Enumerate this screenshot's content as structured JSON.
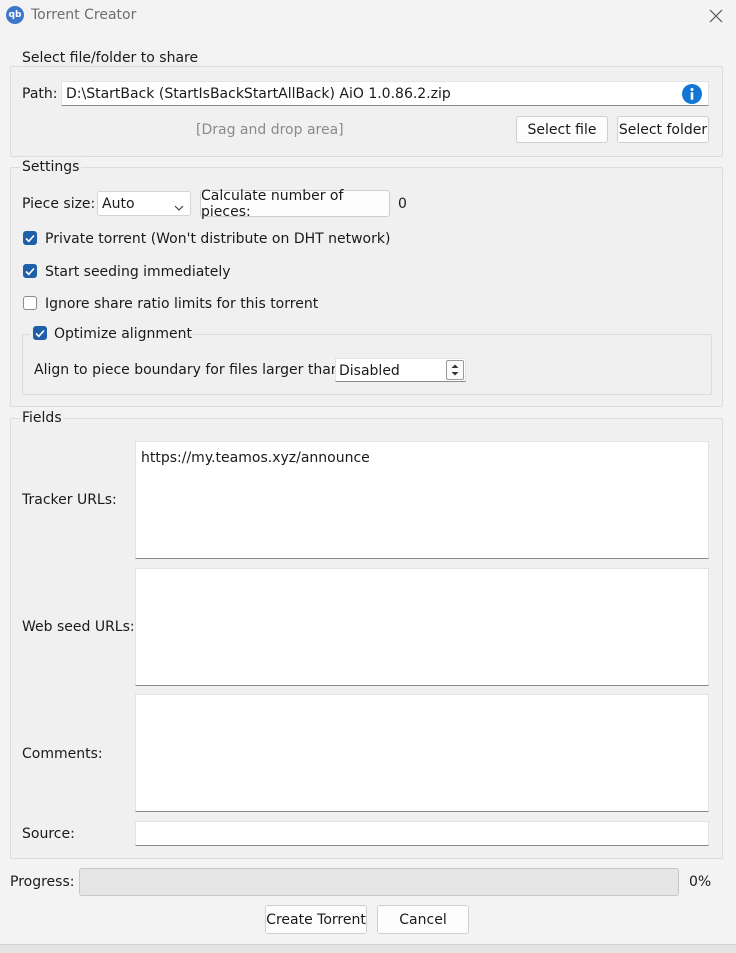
{
  "window": {
    "title": "Torrent Creator",
    "app_icon_text": "qb"
  },
  "file_group": {
    "title": "Select file/folder to share",
    "path_label": "Path:",
    "path_value": "D:\\StartBack (StartIsBackStartAllBack) AiO 1.0.86.2.zip",
    "drag_drop": "[Drag and drop area]",
    "select_file": "Select file",
    "select_folder": "Select folder"
  },
  "settings": {
    "title": "Settings",
    "piece_size_label": "Piece size:",
    "piece_size_value": "Auto",
    "calc_button": "Calculate number of pieces:",
    "pieces_count": "0",
    "private_torrent": {
      "label": "Private torrent (Won't distribute on DHT network)",
      "checked": true
    },
    "start_seeding": {
      "label": "Start seeding immediately",
      "checked": true
    },
    "ignore_ratio": {
      "label": "Ignore share ratio limits for this torrent",
      "checked": false
    },
    "optimize_alignment": {
      "label": "Optimize alignment",
      "checked": true
    },
    "align_label": "Align to piece boundary for files larger than:",
    "align_value": "Disabled"
  },
  "fields": {
    "title": "Fields",
    "tracker_label": "Tracker URLs:",
    "tracker_value": "https://my.teamos.xyz/announce",
    "webseed_label": "Web seed URLs:",
    "webseed_value": "",
    "comments_label": "Comments:",
    "comments_value": "",
    "source_label": "Source:",
    "source_value": ""
  },
  "progress": {
    "label": "Progress:",
    "value_text": "0%",
    "fraction": 0
  },
  "buttons": {
    "create": "Create Torrent",
    "cancel": "Cancel"
  },
  "colors": {
    "accent": "#1f5ea8",
    "info_icon": "#1277d4"
  }
}
